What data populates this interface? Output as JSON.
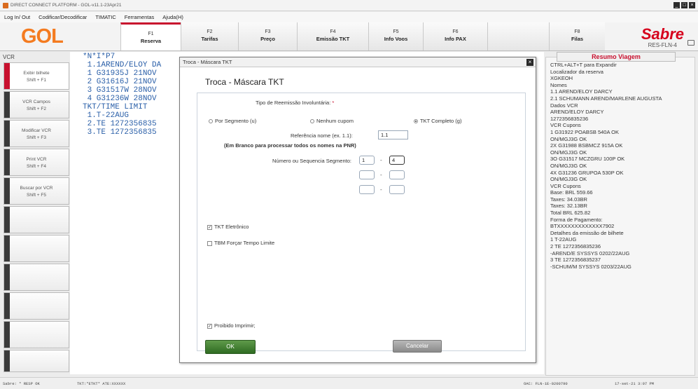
{
  "window": {
    "title": "DIRECT CONNECT PLATFORM - GOL-v11.1-23Apr21"
  },
  "menu": [
    "Log In/ Out",
    "Codificar/Decodificar",
    "TIMATIC",
    "Ferramentas",
    "Ajuda(H)"
  ],
  "logo": "GOL",
  "fkeys": [
    {
      "key": "F1",
      "label": "Reserva"
    },
    {
      "key": "F2",
      "label": "Tarifas"
    },
    {
      "key": "F3",
      "label": "Preço"
    },
    {
      "key": "F4",
      "label": "Emissão TKT"
    },
    {
      "key": "F5",
      "label": "Info Voos"
    },
    {
      "key": "F6",
      "label": "Info PAX"
    },
    {
      "key": "F8",
      "label": "Filas"
    }
  ],
  "sabre": {
    "logo": "Sabre",
    "sub": "RES-FLN-4"
  },
  "vcr_label": "VCR",
  "sidebar": [
    {
      "label": "Exibir bilhete",
      "shortcut": "Shift + F1"
    },
    {
      "label": "VCR Campos",
      "shortcut": "Shift + F2"
    },
    {
      "label": "Modificar VCR",
      "shortcut": "Shift + F3"
    },
    {
      "label": "Print VCR",
      "shortcut": "Shift + F4"
    },
    {
      "label": "Buscar por VCR",
      "shortcut": "Shift + F5"
    }
  ],
  "terminal": "*N*I*P7\n 1.1AREND/ELOY DA\n 1 G31935J 21NOV\n 2 G31616J 21NOV\n 3 G31517W 28NOV\n 4 G31236W 28NOV\nTKT/TIME LIMIT\n 1.T-22AUG\n 2.TE 1272356835\n 3.TE 1272356835",
  "resumo": {
    "title": "Resumo Viagem",
    "lines": [
      "CTRL+ALT+T para Expandir",
      "Localizador da reserva",
      "XGKEOH",
      "Nomes",
      "1.1 AREND/ELOY DARCY",
      "2.1 SCHUMANN AREND/MARLENE AUGUSTA",
      "Dados VCR",
      "AREND/ELOY DARCY",
      "1272356835236",
      "VCR Cupons",
      "1 G31922 POABSB 540A OK",
      "ON/MGJ3G OK",
      "2X G31988 BSBMCZ 915A OK",
      "ON/MGJ3G OK",
      "3O G31517 MCZGRU 100P OK",
      "ON/MGJ3G OK",
      "4X G31236 GRUPOA 530P OK",
      "ON/MGJ3G OK",
      "VCR Cupons",
      "Base: BRL  559.66",
      "Taxes:  34.03BR",
      "Taxes:  32.13BR",
      "Total BRL  625.82",
      "Forma de Pagamento:",
      "BTXXXXXXXXXXXXX7902",
      "Detalhes da emissão de bilhete",
      "1 T-22AUG",
      "2 TE 1272356835236",
      "-AREND/E SYSSYS  0202/22AUG",
      "3 TE 1272356835237",
      "-SCHUM/M SYSSYS  0203/22AUG"
    ]
  },
  "dialog": {
    "title": "Troca - Máscara TKT",
    "heading": "Troca - Máscara TKT",
    "tipo_label": "Tipo de Reemissão Involuntária:",
    "required_mark": "*",
    "radio_segmento": "Por Segmento (u)",
    "radio_nenhum": "Nenhum cupom",
    "radio_completo": "TKT Completo (g)",
    "ref_label": "Referência nome (ex. 1.1):",
    "ref_value": "1.1",
    "note": "(Em Branco para processar todos os nomes na PNR)",
    "seg_label": "Número ou Sequencia Segmento:",
    "seg_from": "1",
    "seg_to": "4",
    "dash": "-",
    "chk_eletronico": "TKT Eletrônico",
    "chk_forcar": "TBM Forçar Tempo Limite",
    "chk_proibido": "Proibido Imprimir;",
    "ok": "OK",
    "cancel": "Cancelar"
  },
  "status": {
    "left": "Sabre: * RESP OK",
    "mid": "TKT:*ETKT* ATE:XXXXXX",
    "oac": "OAC: FLN-1E-0200790",
    "time": "17-set-21 3:07 PM"
  },
  "colors": {
    "gol_orange": "#f47b20",
    "sabre_red": "#d6001c",
    "terminal_blue": "#2a5fa8",
    "ok_green": "#3f7d2f"
  }
}
